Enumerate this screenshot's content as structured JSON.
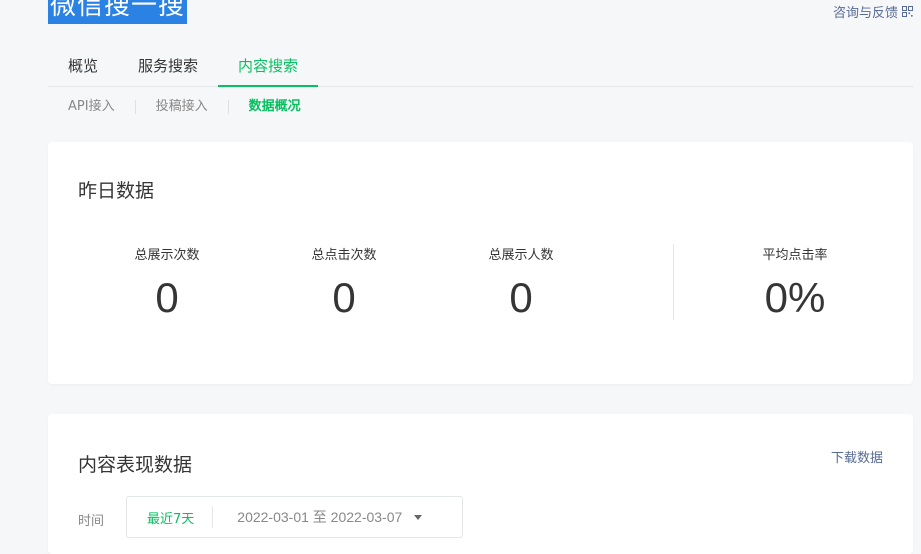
{
  "header": {
    "title": "微信搜一搜",
    "feedback_label": "咨询与反馈"
  },
  "tabs": [
    {
      "label": "概览",
      "active": false
    },
    {
      "label": "服务搜索",
      "active": false
    },
    {
      "label": "内容搜索",
      "active": true
    }
  ],
  "subtabs": [
    {
      "label": "API接入",
      "active": false
    },
    {
      "label": "投稿接入",
      "active": false
    },
    {
      "label": "数据概况",
      "active": true
    }
  ],
  "yesterday": {
    "title": "昨日数据",
    "stats": [
      {
        "label": "总展示次数",
        "value": "0"
      },
      {
        "label": "总点击次数",
        "value": "0"
      },
      {
        "label": "总展示人数",
        "value": "0"
      },
      {
        "label": "平均点击率",
        "value": "0%"
      }
    ]
  },
  "performance": {
    "title": "内容表现数据",
    "download_label": "下载数据",
    "time_label": "时间",
    "quick_range": "最近7天",
    "date_range": "2022-03-01 至 2022-03-07"
  },
  "colors": {
    "accent": "#07c160",
    "link": "#576b95",
    "title_highlight": "#2a82e4"
  }
}
